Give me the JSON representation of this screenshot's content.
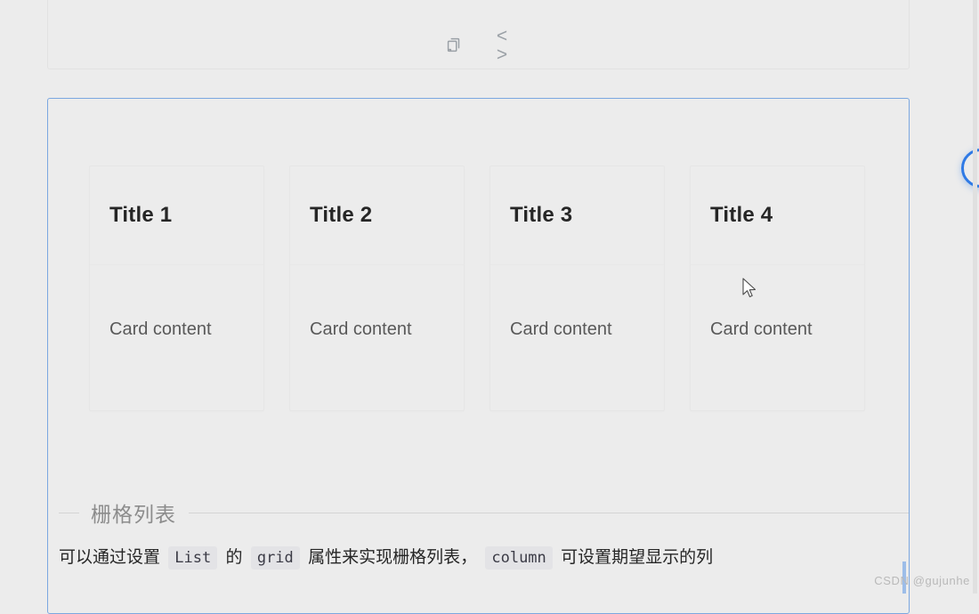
{
  "page": {
    "background_color": "#ececec",
    "accent_color": "#2f7ae5"
  },
  "top_panel": {
    "actions": [
      {
        "name": "copy-icon",
        "label": "copy"
      },
      {
        "name": "code-icon",
        "label": "< >"
      }
    ]
  },
  "focus_container": {
    "border_color": "#7ba7e0"
  },
  "cards": [
    {
      "title": "Title 1",
      "content": "Card content"
    },
    {
      "title": "Title 2",
      "content": "Card content"
    },
    {
      "title": "Title 3",
      "content": "Card content"
    },
    {
      "title": "Title 4",
      "content": "Card content"
    }
  ],
  "section": {
    "heading": "栅格列表",
    "paragraph": {
      "part1": "可以通过设置",
      "code1": "List",
      "part2": "的",
      "code2": "grid",
      "part3": "属性来实现栅格列表，",
      "code3": "column",
      "part4": "可设置期望显示的列"
    }
  },
  "floating_button": {
    "name": "floating-action-button",
    "color": "#2f7ae5"
  },
  "watermark": {
    "text": "CSDN @gujunhe"
  }
}
